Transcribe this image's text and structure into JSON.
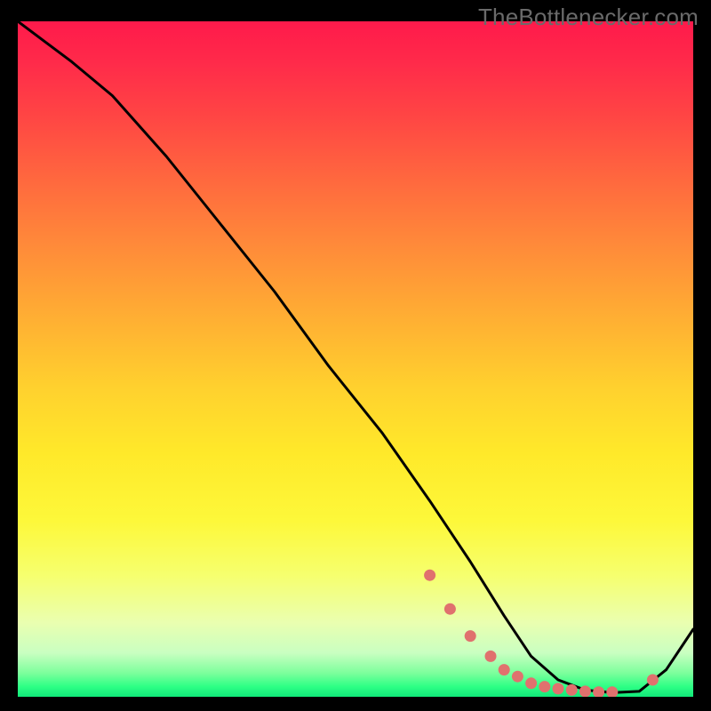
{
  "watermark": "TheBottlenecker.com",
  "chart_data": {
    "type": "line",
    "title": "",
    "xlabel": "",
    "ylabel": "",
    "xlim": [
      0,
      100
    ],
    "ylim": [
      0,
      100
    ],
    "curve": {
      "name": "bottleneck-curve",
      "x": [
        0,
        4,
        8,
        14,
        22,
        30,
        38,
        46,
        54,
        61,
        67,
        72,
        76,
        80,
        84,
        88,
        92,
        96,
        100
      ],
      "y": [
        100,
        97,
        94,
        89,
        80,
        70,
        60,
        49,
        39,
        29,
        20,
        12,
        6,
        2.5,
        1.0,
        0.6,
        0.8,
        4,
        10
      ]
    },
    "markers": {
      "name": "highlight-points",
      "color": "#e0716e",
      "x": [
        61,
        64,
        67,
        70,
        72,
        74,
        76,
        78,
        80,
        82,
        84,
        86,
        88,
        94
      ],
      "y": [
        18,
        13,
        9,
        6,
        4,
        3,
        2,
        1.5,
        1.2,
        1.0,
        0.8,
        0.7,
        0.7,
        2.5
      ]
    },
    "gradient_stops": [
      {
        "pos": 0.0,
        "color": "#ff1a4b"
      },
      {
        "pos": 0.5,
        "color": "#ffd02e"
      },
      {
        "pos": 0.82,
        "color": "#f6ff6e"
      },
      {
        "pos": 1.0,
        "color": "#10e879"
      }
    ]
  }
}
